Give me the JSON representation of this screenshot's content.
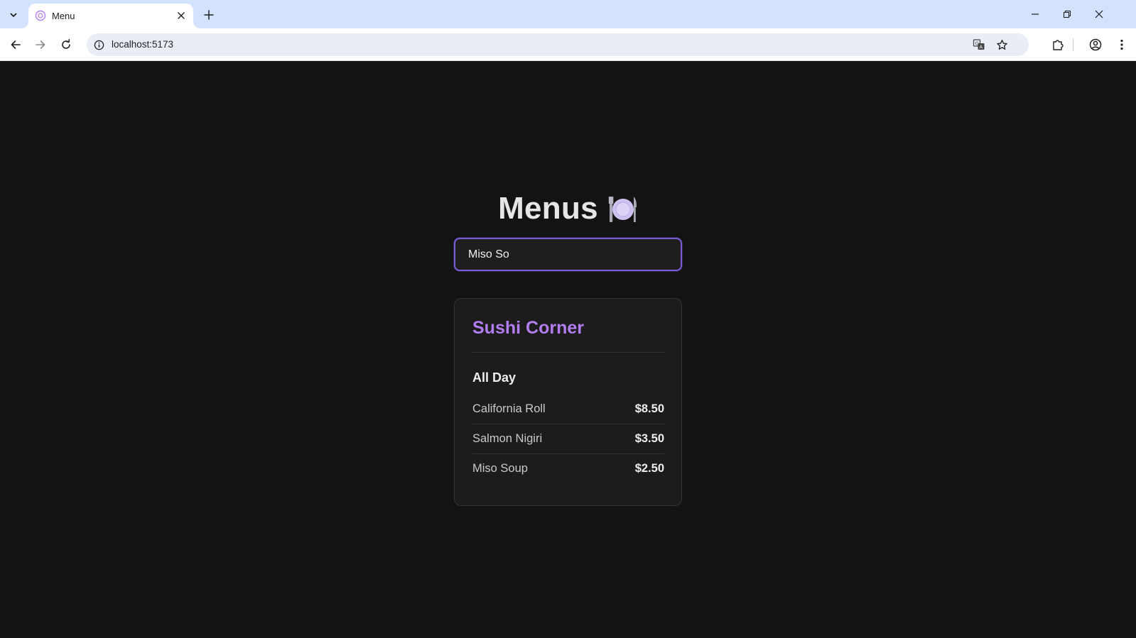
{
  "browser": {
    "tab_title": "Menu",
    "url": "localhost:5173"
  },
  "page": {
    "title": "Menus",
    "title_emoji_icon": "plate-with-cutlery-icon",
    "search": {
      "value": "Miso So",
      "placeholder": ""
    },
    "restaurant": {
      "name": "Sushi Corner",
      "sections": [
        {
          "heading": "All Day",
          "items": [
            {
              "name": "California Roll",
              "price": "$8.50"
            },
            {
              "name": "Salmon Nigiri",
              "price": "$3.50"
            },
            {
              "name": "Miso Soup",
              "price": "$2.50"
            }
          ]
        }
      ]
    }
  },
  "colors": {
    "background": "#131313",
    "card": "#1c1c1c",
    "accent": "#b27df0",
    "input_border": "#7c5cd6"
  }
}
